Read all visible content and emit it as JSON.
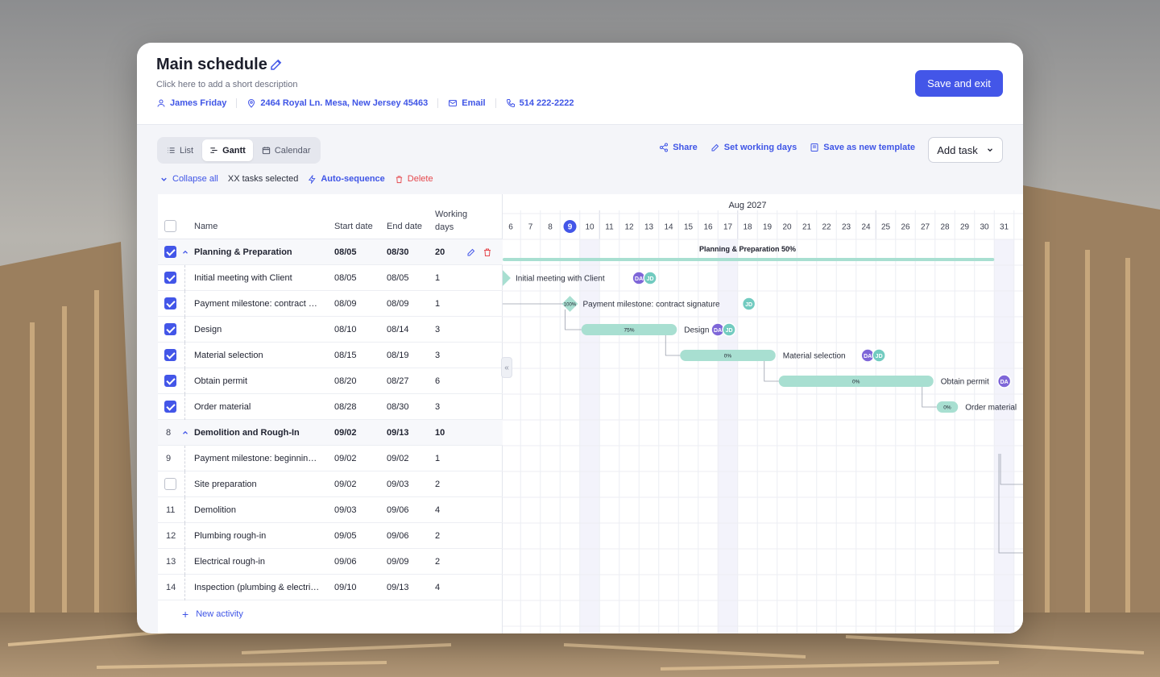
{
  "header": {
    "title": "Main schedule",
    "description": "Click here to add a short description",
    "contacts": [
      {
        "icon": "person-icon",
        "label": "James Friday"
      },
      {
        "icon": "location-pin-icon",
        "label": "2464 Royal Ln. Mesa, New Jersey 45463"
      },
      {
        "icon": "mail-icon",
        "label": "Email"
      },
      {
        "icon": "phone-icon",
        "label": "514 222-2222"
      }
    ],
    "save_label": "Save and exit"
  },
  "views": [
    {
      "icon": "list-icon",
      "label": "List",
      "active": false
    },
    {
      "icon": "gantt-icon",
      "label": "Gantt",
      "active": true
    },
    {
      "icon": "calendar-icon",
      "label": "Calendar",
      "active": false
    }
  ],
  "actions": {
    "share": "Share",
    "working_days": "Set working days",
    "save_template": "Save as new template",
    "add_task": "Add task"
  },
  "bulk": {
    "collapse_all": "Collapse all",
    "selected": "XX tasks selected",
    "auto_sequence": "Auto-sequence",
    "delete": "Delete"
  },
  "table": {
    "columns": {
      "name": "Name",
      "start": "Start date",
      "end": "End date",
      "working": "Working days"
    },
    "rows": [
      {
        "num": "",
        "checked": true,
        "group": true,
        "name": "Planning & Preparation",
        "start": "08/05",
        "end": "08/30",
        "days": "20"
      },
      {
        "num": "",
        "checked": true,
        "group": false,
        "name": "Initial meeting with Client",
        "start": "08/05",
        "end": "08/05",
        "days": "1"
      },
      {
        "num": "",
        "checked": true,
        "group": false,
        "name": "Payment milestone: contract signature",
        "start": "08/09",
        "end": "08/09",
        "days": "1"
      },
      {
        "num": "",
        "checked": true,
        "group": false,
        "name": "Design",
        "start": "08/10",
        "end": "08/14",
        "days": "3"
      },
      {
        "num": "",
        "checked": true,
        "group": false,
        "name": "Material selection",
        "start": "08/15",
        "end": "08/19",
        "days": "3"
      },
      {
        "num": "",
        "checked": true,
        "group": false,
        "name": "Obtain permit",
        "start": "08/20",
        "end": "08/27",
        "days": "6"
      },
      {
        "num": "",
        "checked": true,
        "group": false,
        "name": "Order material",
        "start": "08/28",
        "end": "08/30",
        "days": "3"
      },
      {
        "num": "8",
        "checked": null,
        "group": true,
        "name": "Demolition and Rough-In",
        "start": "09/02",
        "end": "09/13",
        "days": "10"
      },
      {
        "num": "9",
        "checked": null,
        "group": false,
        "name": "Payment milestone: beginning of demolition",
        "start": "09/02",
        "end": "09/02",
        "days": "1"
      },
      {
        "num": "",
        "checked": false,
        "group": false,
        "name": "Site preparation",
        "start": "09/02",
        "end": "09/03",
        "days": "2"
      },
      {
        "num": "11",
        "checked": null,
        "group": false,
        "name": "Demolition",
        "start": "09/03",
        "end": "09/06",
        "days": "4"
      },
      {
        "num": "12",
        "checked": null,
        "group": false,
        "name": "Plumbing rough-in",
        "start": "09/05",
        "end": "09/06",
        "days": "2"
      },
      {
        "num": "13",
        "checked": null,
        "group": false,
        "name": "Electrical rough-in",
        "start": "09/06",
        "end": "09/09",
        "days": "2"
      },
      {
        "num": "14",
        "checked": null,
        "group": false,
        "name": "Inspection (plumbing & electrical)",
        "start": "09/10",
        "end": "09/13",
        "days": "4"
      }
    ],
    "new_activity": "New activity"
  },
  "gantt": {
    "month": "Aug 2027",
    "days": [
      "6",
      "7",
      "8",
      "9",
      "10",
      "11",
      "12",
      "13",
      "14",
      "15",
      "16",
      "17",
      "18",
      "19",
      "20",
      "21",
      "22",
      "23",
      "24",
      "25",
      "26",
      "27",
      "28",
      "29",
      "30",
      "31"
    ],
    "today": "9",
    "weekend_days": [
      "10",
      "17",
      "31"
    ],
    "week_starts": [
      "11",
      "18",
      "25"
    ],
    "group_bar": {
      "label": "Planning & Preparation 50%",
      "from": "5",
      "to": "30"
    },
    "tasks": [
      {
        "name": "Initial meeting with Client",
        "type": "milestone",
        "day": "5",
        "assignees": [
          "DA",
          "JD"
        ]
      },
      {
        "name": "Payment milestone: contract signature",
        "type": "milestone",
        "day": "9",
        "progress": "100%",
        "assignees": [
          "JD"
        ]
      },
      {
        "name": "Design",
        "type": "bar",
        "from": "10",
        "to": "14",
        "progress": "75%",
        "assignees": [
          "DA",
          "JD"
        ]
      },
      {
        "name": "Material selection",
        "type": "bar",
        "from": "15",
        "to": "19",
        "progress": "0%",
        "assignees": [
          "DA",
          "JD"
        ]
      },
      {
        "name": "Obtain permit",
        "type": "bar",
        "from": "20",
        "to": "27",
        "progress": "0%",
        "assignees": [
          "DA"
        ]
      },
      {
        "name": "Order material",
        "type": "bar",
        "from": "28",
        "to": "28",
        "progress": "0%",
        "assignees": []
      }
    ],
    "colors": {
      "bar": "#a8dfd1",
      "today": "#4356e8",
      "avatar_da": "#7e66d8",
      "avatar_jd": "#72cbc0",
      "avatar_teal": "#31b38e"
    }
  }
}
